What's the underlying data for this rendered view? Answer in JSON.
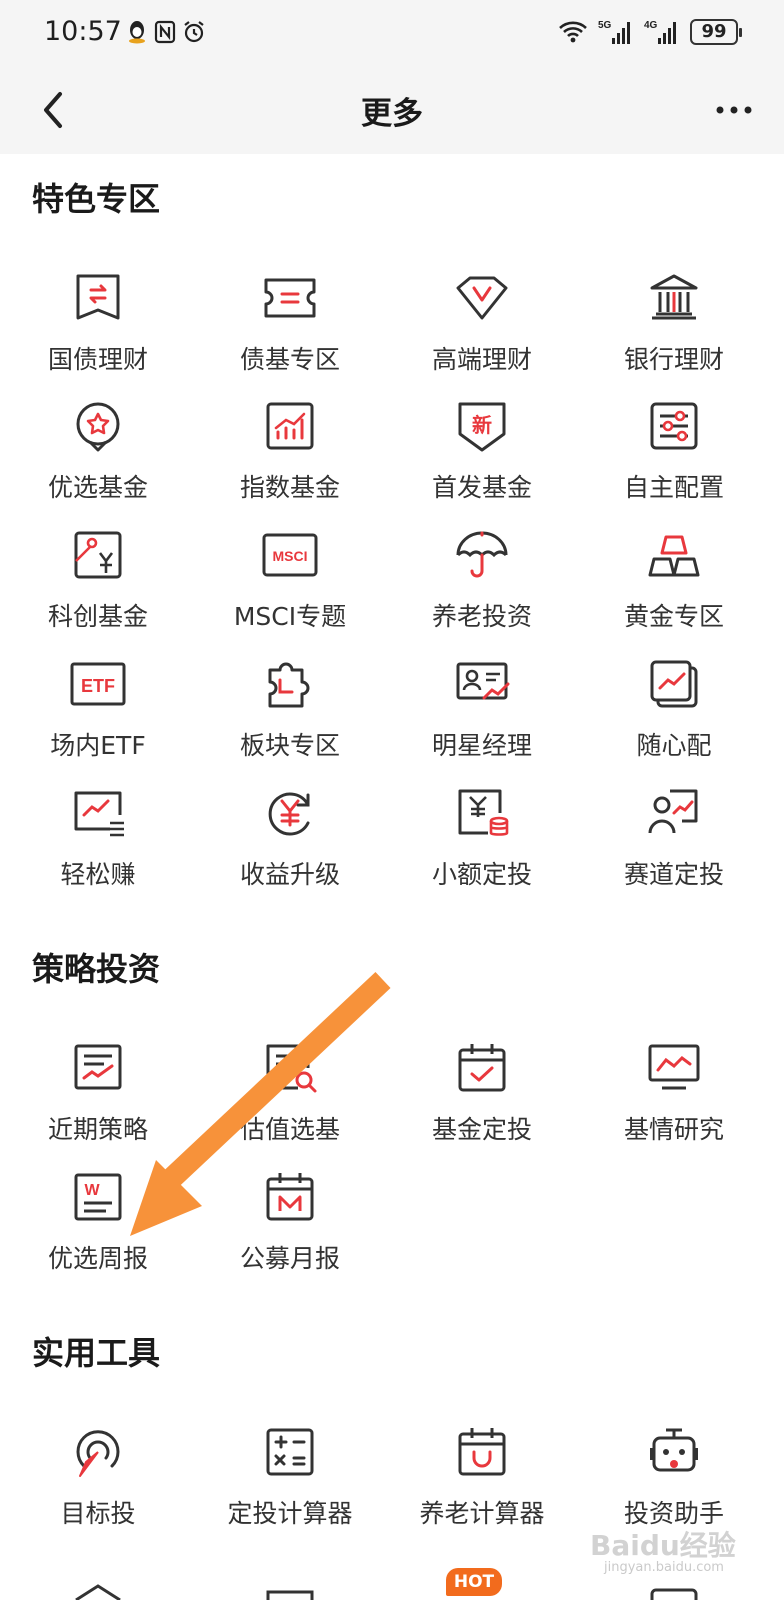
{
  "status_bar": {
    "time": "10:57",
    "battery": "99",
    "net1": "5G",
    "net2": "4G"
  },
  "nav": {
    "title": "更多"
  },
  "sections": {
    "featured": {
      "title": "特色专区"
    },
    "strategy": {
      "title": "策略投资"
    },
    "tools": {
      "title": "实用工具"
    }
  },
  "featured_items": [
    "国债理财",
    "债基专区",
    "高端理财",
    "银行理财",
    "优选基金",
    "指数基金",
    "首发基金",
    "自主配置",
    "科创基金",
    "MSCI专题",
    "养老投资",
    "黄金专区",
    "场内ETF",
    "板块专区",
    "明星经理",
    "随心配",
    "轻松赚",
    "收益升级",
    "小额定投",
    "赛道定投"
  ],
  "strategy_items": [
    "近期策略",
    "估值选基",
    "基金定投",
    "基情研究",
    "优选周报",
    "公募月报"
  ],
  "tools_items": [
    "目标投",
    "定投计算器",
    "养老计算器",
    "投资助手"
  ],
  "badge": {
    "hot": "HOT"
  },
  "watermark": {
    "text": "Baidu经验",
    "sub": "jingyan.baidu.com"
  },
  "colors": {
    "accent": "#e8383d",
    "icon_stroke": "#333333",
    "arrow": "#f7923a",
    "hot": "#f26b1d"
  }
}
